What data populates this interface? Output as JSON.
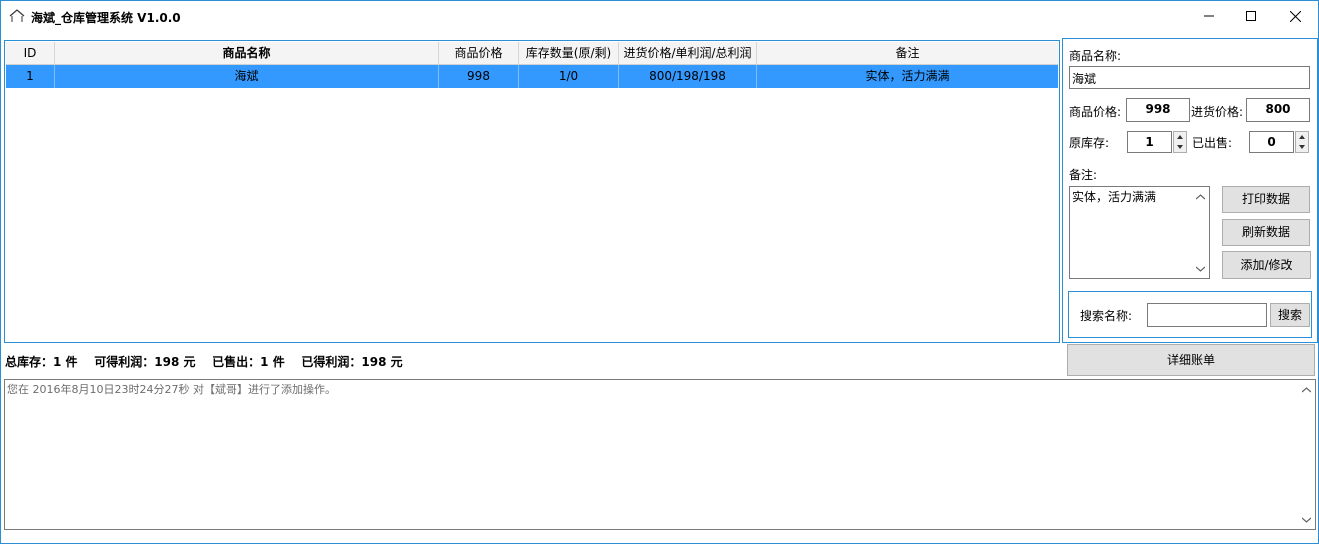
{
  "window": {
    "title": "海斌_仓库管理系统 V1.0.0",
    "buttons": [
      "minimize",
      "maximize",
      "close"
    ]
  },
  "colors": {
    "accent": "#2b8fd6",
    "row_selected": "#3399ff",
    "button_bg": "#e1e1e1"
  },
  "table": {
    "columns": [
      "ID",
      "商品名称",
      "商品价格",
      "库存数量(原/剩)",
      "进货价格/单利润/总利润",
      "备注"
    ],
    "rows": [
      [
        "1",
        "海斌",
        "998",
        "1/0",
        "800/198/198",
        "实体，活力满满"
      ]
    ]
  },
  "form": {
    "name_label": "商品名称:",
    "name_value": "海斌",
    "price_label": "商品价格:",
    "price_value": "998",
    "cost_label": "进货价格:",
    "cost_value": "800",
    "stock_label": "原库存:",
    "stock_value": "1",
    "sold_label": "已出售:",
    "sold_value": "0",
    "note_label": "备注:",
    "note_value": "实体，活力满满"
  },
  "actions": {
    "print": "打印数据",
    "refresh": "刷新数据",
    "add_modify": "添加/修改",
    "search_label": "搜索名称:",
    "search_value": "",
    "search_button": "搜索",
    "detail_button": "详细账单"
  },
  "status": {
    "text": "总库存：1 件    可得利润：198 元    已售出：1 件    已得利润：198 元"
  },
  "log": {
    "text": "您在 2016年8月10日23时24分27秒 对【斌哥】进行了添加操作。"
  },
  "icons": {
    "app": "house-roof-icon",
    "minimize": "minimize-icon",
    "maximize": "maximize-icon",
    "close": "close-icon",
    "spin_up": "spin-up-arrow-icon",
    "spin_down": "spin-down-arrow-icon",
    "scroll_up": "scroll-up-arrow-icon",
    "scroll_down": "scroll-down-arrow-icon"
  }
}
